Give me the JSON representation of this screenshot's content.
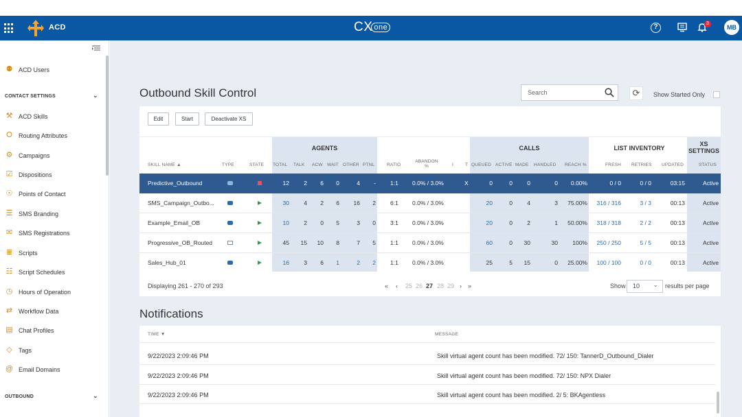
{
  "topbar": {
    "app_name": "ACD",
    "brand_main": "CX",
    "brand_sub": "one",
    "notification_count": "3",
    "avatar_initials": "MB",
    "color": "#0a58a3"
  },
  "sidebar": {
    "items_top": [
      {
        "label": "ACD Users",
        "icon": "user-icon"
      }
    ],
    "section_contact": "CONTACT SETTINGS",
    "items": [
      {
        "label": "ACD Skills",
        "icon": "skills-icon"
      },
      {
        "label": "Routing Attributes",
        "icon": "routing-icon"
      },
      {
        "label": "Campaigns",
        "icon": "gear-icon"
      },
      {
        "label": "Dispositions",
        "icon": "checklist-icon"
      },
      {
        "label": "Points of Contact",
        "icon": "compass-icon"
      },
      {
        "label": "SMS Branding",
        "icon": "chat-icon"
      },
      {
        "label": "SMS Registrations",
        "icon": "sms-icon"
      },
      {
        "label": "Scripts",
        "icon": "script-icon"
      },
      {
        "label": "Script Schedules",
        "icon": "schedule-icon"
      },
      {
        "label": "Hours of Operation",
        "icon": "clock-icon"
      },
      {
        "label": "Workflow Data",
        "icon": "workflow-icon"
      },
      {
        "label": "Chat Profiles",
        "icon": "chat-profile-icon"
      },
      {
        "label": "Tags",
        "icon": "tag-icon"
      },
      {
        "label": "Email Domains",
        "icon": "at-icon"
      }
    ],
    "section_outbound": "OUTBOUND"
  },
  "page": {
    "title": "Outbound Skill Control",
    "search_placeholder": "Search",
    "started_only_label": "Show Started Only"
  },
  "toolbar": {
    "edit": "Edit",
    "start": "Start",
    "deactivate": "Deactivate XS"
  },
  "table": {
    "groups": {
      "agents": "AGENTS",
      "calls": "CALLS",
      "list_inventory": "LIST INVENTORY",
      "xs_settings_1": "XS",
      "xs_settings_2": "SETTINGS"
    },
    "headers": {
      "skill_name": "SKILL NAME",
      "type": "TYPE",
      "state": "STATE",
      "total": "TOTAL",
      "talk": "TALK",
      "acw": "ACW",
      "wait": "WAIT",
      "other": "OTHER",
      "ptnl": "PTNL",
      "ratio": "RATIO",
      "abandon_1": "ABANDON",
      "abandon_2": "%",
      "i": "I",
      "t": "T",
      "queued": "QUEUED",
      "active": "ACTIVE",
      "made": "MADE",
      "handled": "HANDLED",
      "reach": "REACH %",
      "fresh": "FRESH",
      "retries": "RETRIES",
      "updated": "UPDATED",
      "status": "STATUS"
    },
    "rows": [
      {
        "name": "Predictive_Outbound",
        "type": "phone",
        "state": "stopped",
        "total": "12",
        "talk": "2",
        "acw": "6",
        "wait": "0",
        "other": "4",
        "ptnl": "-",
        "ratio": "1:1",
        "abandon": "0.0% / 3.0%",
        "i": "",
        "t": "X",
        "queued": "0",
        "active": "0",
        "made": "0",
        "handled": "0",
        "reach": "0.00%",
        "fresh": "0 / 0",
        "retries": "0 / 0",
        "updated": "03:15",
        "status": "Active"
      },
      {
        "name": "SMS_Campaign_Outbo...",
        "type": "phone",
        "state": "running",
        "total": "30",
        "talk": "4",
        "acw": "2",
        "wait": "6",
        "other": "16",
        "ptnl": "2",
        "ratio": "6:1",
        "abandon": "0.0% / 3.0%",
        "i": "",
        "t": "",
        "queued": "20",
        "active": "0",
        "made": "4",
        "handled": "3",
        "reach": "75.00%",
        "fresh": "316 / 316",
        "retries": "3 / 3",
        "updated": "00:13",
        "status": "Active"
      },
      {
        "name": "Example_Email_OB",
        "type": "phone",
        "state": "running",
        "total": "10",
        "talk": "2",
        "acw": "0",
        "wait": "5",
        "other": "3",
        "ptnl": "0",
        "ratio": "3:1",
        "abandon": "0.0% / 3.0%",
        "i": "",
        "t": "",
        "queued": "20",
        "active": "0",
        "made": "2",
        "handled": "1",
        "reach": "50.00%",
        "fresh": "318 / 318",
        "retries": "2 / 2",
        "updated": "00:13",
        "status": "Active"
      },
      {
        "name": "Progressive_OB_Routed",
        "type": "mail",
        "state": "running",
        "total": "45",
        "talk": "15",
        "acw": "10",
        "wait": "8",
        "other": "7",
        "ptnl": "5",
        "ratio": "1:1",
        "abandon": "0.0% / 3.0%",
        "i": "",
        "t": "",
        "queued": "60",
        "active": "0",
        "made": "30",
        "handled": "30",
        "reach": "100%",
        "fresh": "250 / 250",
        "retries": "5 / 5",
        "updated": "00:13",
        "status": "Active"
      },
      {
        "name": "Sales_Hub_01",
        "type": "phone",
        "state": "running",
        "total": "16",
        "talk": "3",
        "acw": "6",
        "wait": "1",
        "other": "2",
        "ptnl": "2",
        "ratio": "1:1",
        "abandon": "0.0% / 3.0%",
        "i": "",
        "t": "",
        "queued": "25",
        "active": "5",
        "made": "15",
        "handled": "0",
        "reach": "25.00%",
        "fresh": "100 / 100",
        "retries": "0 / 0",
        "updated": "00:13",
        "status": "Active"
      }
    ]
  },
  "pager": {
    "displaying": "Displaying 261 - 270 of 293",
    "first": "«",
    "prev": "‹",
    "pages": [
      "25",
      "26",
      "27",
      "28",
      "29"
    ],
    "current": "27",
    "next": "›",
    "last": "»",
    "show_label": "Show",
    "per_page": "10",
    "per_page_suffix": "results per page"
  },
  "notifications": {
    "title": "Notifications",
    "col_time": "TIME",
    "col_message": "MESSAGE",
    "rows": [
      {
        "time": "9/22/2023 2:09:46 PM",
        "message": "Skill virtual agent count has been modified. 72/ 150: TannerD_Outbound_Dialer"
      },
      {
        "time": "9/22/2023 2:09:46 PM",
        "message": "Skill virtual agent count has been modified. 72/ 150: NPX Dialer"
      },
      {
        "time": "9/22/2023 2:09:46 PM",
        "message": "Skill virtual agent count has been modified. 2/ 5: BKAgentless"
      }
    ]
  }
}
